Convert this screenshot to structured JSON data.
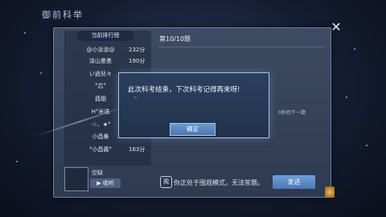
{
  "app": {
    "title": "御前科举"
  },
  "ranking": {
    "header": "当前排行榜",
    "rows": [
      {
        "name": "@小涂涂@",
        "score": "232分"
      },
      {
        "name": "涂山墨墨",
        "score": "190分"
      },
      {
        "name": "い過兒々",
        "score": ""
      },
      {
        "name": "°芯°",
        "score": ""
      },
      {
        "name": "孤烟",
        "score": ""
      },
      {
        "name": "H°米诺",
        "score": ""
      },
      {
        "name": "·☆、★°",
        "score": ""
      },
      {
        "name": "小昌桑",
        "score": ""
      },
      {
        "name": "°小昌酱°",
        "score": "163分"
      }
    ]
  },
  "question": {
    "label": "第10/10题",
    "countdown": "0秒后下一题"
  },
  "user": {
    "name": "空缺",
    "collapse_label": "▶ 收听"
  },
  "notice": {
    "text": "你正处于围观模式，无法答题。",
    "send_label": "发送"
  },
  "dialog": {
    "message": "此次科考结束，下次科考记得再来呀!",
    "confirm_label": "确定"
  },
  "icons": {
    "close": "close-icon",
    "view": "view-mode-icon",
    "dialog": "dialog-decor-icon"
  }
}
